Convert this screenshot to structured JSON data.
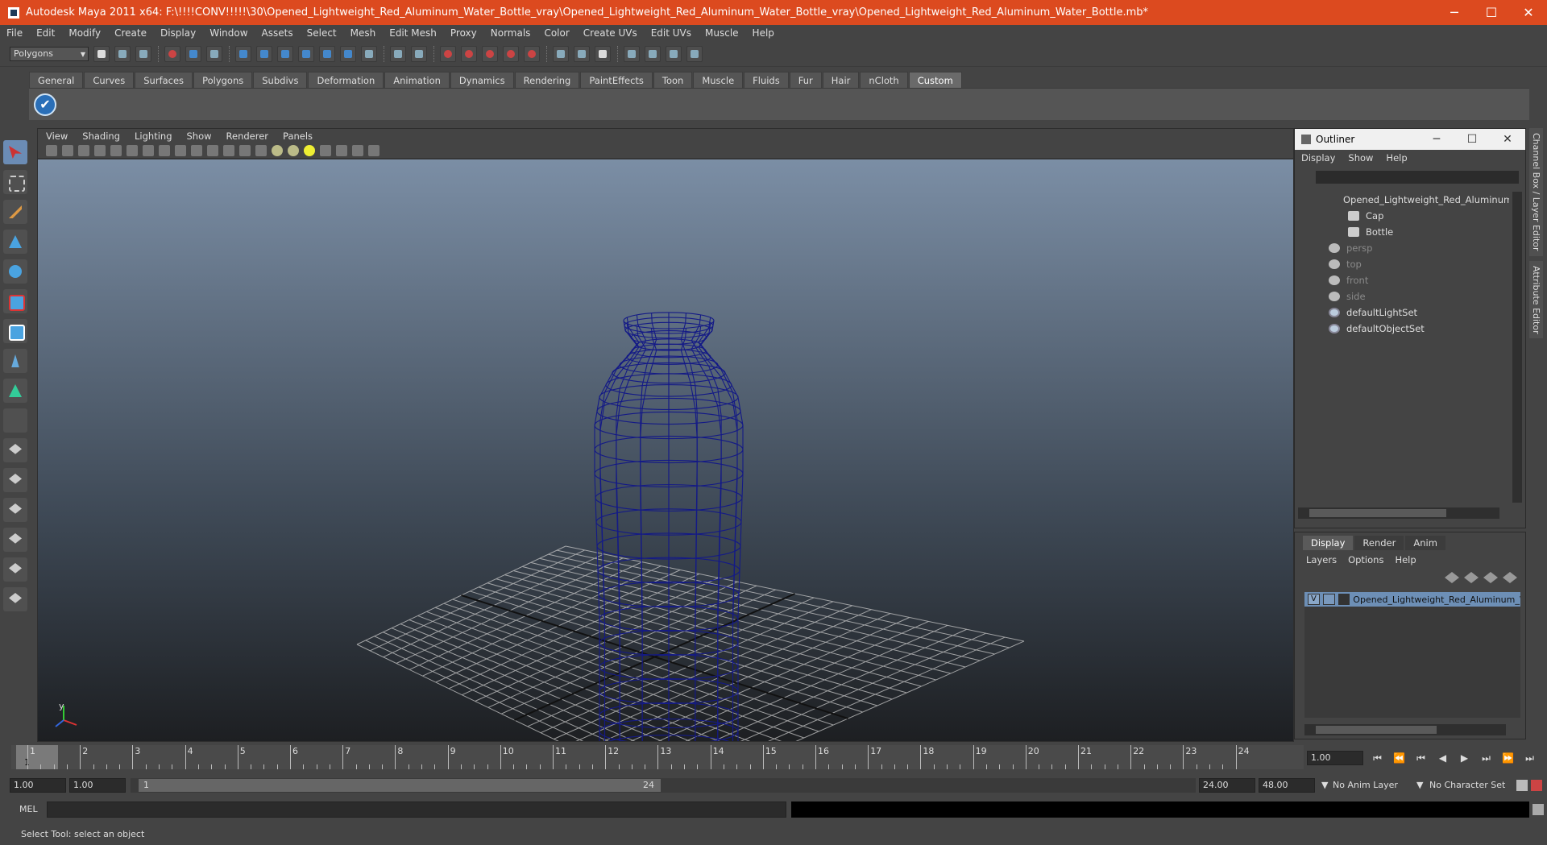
{
  "window": {
    "title": "Autodesk Maya 2011 x64: F:\\!!!!CONV!!!!!\\30\\Opened_Lightweight_Red_Aluminum_Water_Bottle_vray\\Opened_Lightweight_Red_Aluminum_Water_Bottle_vray\\Opened_Lightweight_Red_Aluminum_Water_Bottle.mb*",
    "minimize": "─",
    "maximize": "☐",
    "close": "✕"
  },
  "menubar": [
    "File",
    "Edit",
    "Modify",
    "Create",
    "Display",
    "Window",
    "Assets",
    "Select",
    "Mesh",
    "Edit Mesh",
    "Proxy",
    "Normals",
    "Color",
    "Create UVs",
    "Edit UVs",
    "Muscle",
    "Help"
  ],
  "statusline": {
    "mode": "Polygons"
  },
  "shelf": {
    "tabs": [
      "General",
      "Curves",
      "Surfaces",
      "Polygons",
      "Subdivs",
      "Deformation",
      "Animation",
      "Dynamics",
      "Rendering",
      "PaintEffects",
      "Toon",
      "Muscle",
      "Fluids",
      "Fur",
      "Hair",
      "nCloth",
      "Custom"
    ],
    "active_tab": "Custom",
    "icon_glyph": "✔"
  },
  "viewport": {
    "menu": [
      "View",
      "Shading",
      "Lighting",
      "Show",
      "Renderer",
      "Panels"
    ],
    "axis_label": "y"
  },
  "outliner": {
    "title": "Outliner",
    "minimize": "─",
    "maximize": "☐",
    "close": "✕",
    "menu": [
      "Display",
      "Show",
      "Help"
    ],
    "items": [
      {
        "label": "Opened_Lightweight_Red_Aluminum_W",
        "dim": false,
        "icon": "mesh-icon"
      },
      {
        "label": "Cap",
        "dim": false,
        "icon": "mesh-icon"
      },
      {
        "label": "Bottle",
        "dim": false,
        "icon": "mesh-icon"
      },
      {
        "label": "persp",
        "dim": true,
        "icon": "camera-icon"
      },
      {
        "label": "top",
        "dim": true,
        "icon": "camera-icon"
      },
      {
        "label": "front",
        "dim": true,
        "icon": "camera-icon"
      },
      {
        "label": "side",
        "dim": true,
        "icon": "camera-icon"
      },
      {
        "label": "defaultLightSet",
        "dim": false,
        "icon": "set-icon"
      },
      {
        "label": "defaultObjectSet",
        "dim": false,
        "icon": "set-icon"
      }
    ]
  },
  "layer_editor": {
    "tabs": [
      "Display",
      "Render",
      "Anim"
    ],
    "active_tab": "Display",
    "menu": [
      "Layers",
      "Options",
      "Help"
    ],
    "layer": {
      "visible_flag": "V",
      "name": "Opened_Lightweight_Red_Aluminum_Wat"
    }
  },
  "side_tabs": [
    "Channel Box / Layer Editor",
    "Attribute Editor"
  ],
  "timeline": {
    "ticks": [
      "1",
      "2",
      "3",
      "4",
      "5",
      "6",
      "7",
      "8",
      "9",
      "10",
      "11",
      "12",
      "13",
      "14",
      "15",
      "16",
      "17",
      "18",
      "19",
      "20",
      "21",
      "22",
      "23",
      "24"
    ],
    "current_frame": "1",
    "current_time_field": "1.00",
    "playback_buttons": [
      "⏮",
      "⏪",
      "⏮",
      "◀",
      "▶",
      "⏭",
      "⏩",
      "⏭"
    ]
  },
  "range": {
    "start_time": "1.00",
    "playback_start": "1.00",
    "handle_start": "1",
    "handle_end": "24",
    "playback_end": "24.00",
    "end_time": "48.00",
    "anim_layer": "No Anim Layer",
    "character_set": "No Character Set"
  },
  "command": {
    "label": "MEL"
  },
  "helpline": {
    "text": "Select Tool: select an object"
  }
}
